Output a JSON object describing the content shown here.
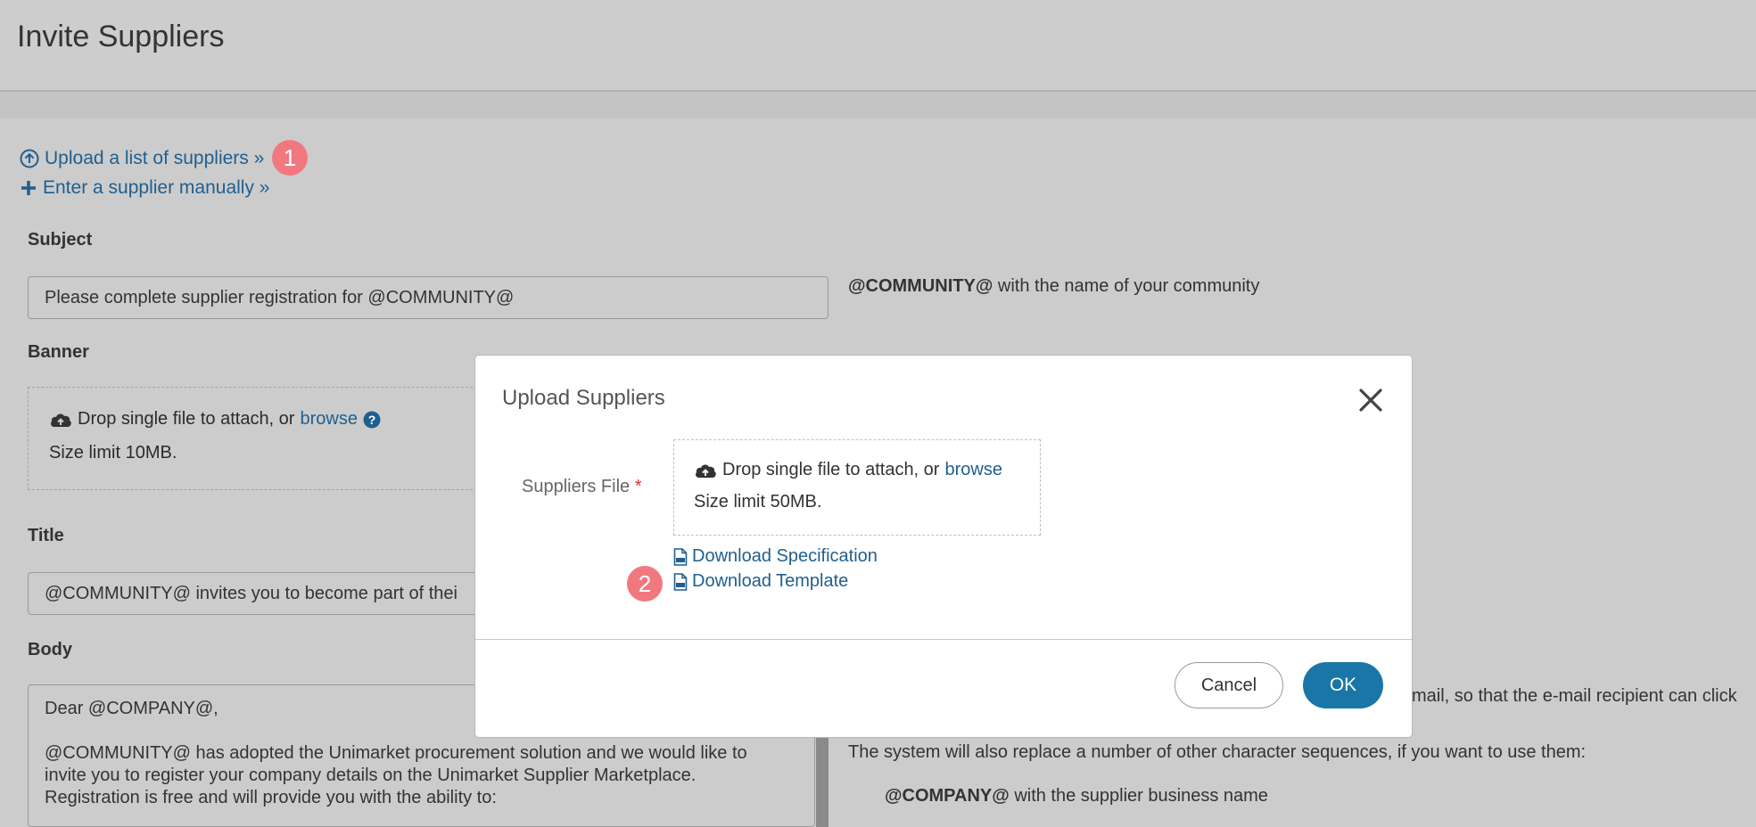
{
  "page": {
    "title": "Invite Suppliers"
  },
  "actions": {
    "upload_list": "Upload a list of suppliers »",
    "enter_manually": "Enter a supplier manually »",
    "step1": "1"
  },
  "form": {
    "subject_label": "Subject",
    "subject_value": "Please complete supplier registration for @COMMUNITY@",
    "subject_hint_token": "@COMMUNITY@",
    "subject_hint_text": "with the name of your community",
    "banner_label": "Banner",
    "banner_drop_text": "Drop single file to attach, or",
    "banner_browse": "browse",
    "banner_size_limit": "Size limit 10MB.",
    "title_label": "Title",
    "title_value": "@COMMUNITY@ invites you to become part of thei",
    "body_label": "Body",
    "body_lines": [
      "Dear @COMPANY@,",
      "",
      "@COMMUNITY@ has adopted the Unimarket procurement solution and we would like to",
      "invite you to register your company details on the Unimarket Supplier Marketplace.",
      "Registration is free and will provide you with the ability to:"
    ],
    "body_hint_1": "mail, so that the e-mail recipient can click",
    "body_hint_2": "The system will also replace a number of other character sequences, if you want to use them:",
    "body_hint_3_token": "@COMPANY@",
    "body_hint_3_text": "with the supplier business name"
  },
  "modal": {
    "title": "Upload Suppliers",
    "file_label": "Suppliers File",
    "required_mark": "*",
    "drop_text": "Drop single file to attach, or",
    "browse": "browse",
    "size_limit": "Size limit 50MB.",
    "download_spec": "Download Specification",
    "download_template": "Download Template",
    "step2": "2",
    "cancel": "Cancel",
    "ok": "OK"
  }
}
